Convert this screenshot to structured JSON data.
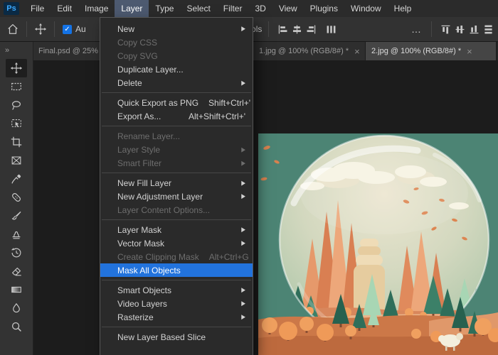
{
  "menubar": {
    "logo": "Ps",
    "items": [
      "File",
      "Edit",
      "Image",
      "Layer",
      "Type",
      "Select",
      "Filter",
      "3D",
      "View",
      "Plugins",
      "Window",
      "Help"
    ],
    "open_menu": "Layer"
  },
  "options_bar": {
    "auto_select_fragment": "Au",
    "controls_fragment": "Controls",
    "checkbox_check": "✓",
    "more_options": "…"
  },
  "tabs": [
    {
      "label": "Final.psd @ 25%",
      "state": "inactive"
    },
    {
      "label": "1.jpg @ 100% (RGB/8#) *",
      "state": "inactive",
      "close": "×"
    },
    {
      "label": "2.jpg @ 100% (RGB/8#) *",
      "state": "active",
      "close": "×"
    }
  ],
  "tools_panel": {
    "expand_chevrons": "»",
    "selected_tool": "move",
    "tools": [
      "move",
      "rectangular-marquee",
      "lasso",
      "object-selection",
      "crop",
      "frame",
      "eyedropper",
      "spot-healing-brush",
      "brush",
      "clone-stamp",
      "history-brush",
      "eraser",
      "gradient",
      "blur",
      "dodge"
    ]
  },
  "layer_menu": {
    "submenu_arrow": "▶",
    "items": [
      {
        "label": "New",
        "submenu": true
      },
      {
        "label": "Copy CSS",
        "disabled": true
      },
      {
        "label": "Copy SVG",
        "disabled": true
      },
      {
        "label": "Duplicate Layer..."
      },
      {
        "label": "Delete",
        "submenu": true
      },
      {
        "separator": true
      },
      {
        "label": "Quick Export as PNG",
        "shortcut": "Shift+Ctrl+'"
      },
      {
        "label": "Export As...",
        "shortcut": "Alt+Shift+Ctrl+'"
      },
      {
        "separator": true
      },
      {
        "label": "Rename Layer...",
        "disabled": true
      },
      {
        "label": "Layer Style",
        "submenu": true,
        "disabled": true
      },
      {
        "label": "Smart Filter",
        "submenu": true,
        "disabled": true
      },
      {
        "separator": true
      },
      {
        "label": "New Fill Layer",
        "submenu": true
      },
      {
        "label": "New Adjustment Layer",
        "submenu": true
      },
      {
        "label": "Layer Content Options...",
        "disabled": true
      },
      {
        "separator": true
      },
      {
        "label": "Layer Mask",
        "submenu": true
      },
      {
        "label": "Vector Mask",
        "submenu": true
      },
      {
        "label": "Create Clipping Mask",
        "shortcut": "Alt+Ctrl+G",
        "disabled": true
      },
      {
        "label": "Mask All Objects",
        "highlighted": true
      },
      {
        "separator": true
      },
      {
        "label": "Smart Objects",
        "submenu": true
      },
      {
        "label": "Video Layers",
        "submenu": true
      },
      {
        "label": "Rasterize",
        "submenu": true
      },
      {
        "separator": true
      },
      {
        "label": "New Layer Based Slice"
      }
    ]
  },
  "artwork": {
    "description": "Paper-craft landscape of coral rock spires and teal pine trees inside a glass sphere on a teal background",
    "background_color": "#4c8474"
  },
  "colors": {
    "menu_highlight": "#2273dd",
    "checkbox_accent": "#1473e6",
    "ps_logo_bg": "#0a2a45",
    "ps_logo_fg": "#3caaff",
    "canvas_background": "#1c1c1c"
  }
}
